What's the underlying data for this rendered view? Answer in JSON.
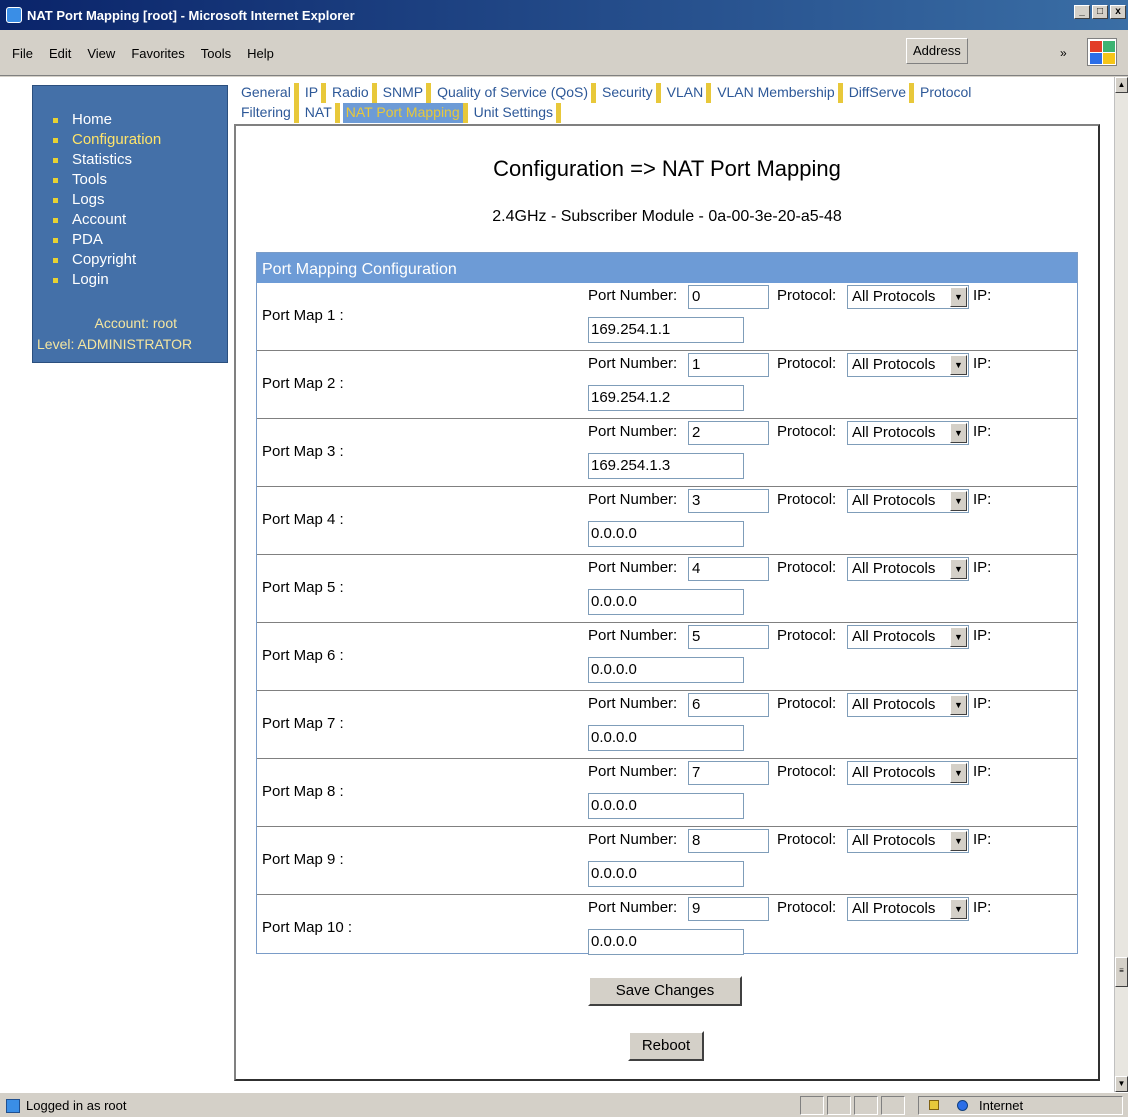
{
  "window": {
    "title": "NAT Port Mapping [root] - Microsoft Internet Explorer",
    "minimize": "_",
    "maximize": "□",
    "close": "x"
  },
  "menubar": {
    "items": [
      "File",
      "Edit",
      "View",
      "Favorites",
      "Tools",
      "Help"
    ],
    "address_label": "Address",
    "overflow": "»"
  },
  "sidebar": {
    "items": [
      {
        "label": "Home",
        "active": false
      },
      {
        "label": "Configuration",
        "active": true
      },
      {
        "label": "Statistics",
        "active": false
      },
      {
        "label": "Tools",
        "active": false
      },
      {
        "label": "Logs",
        "active": false
      },
      {
        "label": "Account",
        "active": false
      },
      {
        "label": "PDA",
        "active": false
      },
      {
        "label": "Copyright",
        "active": false
      },
      {
        "label": "Login",
        "active": false
      }
    ],
    "account": "Account: root",
    "level": "Level: ADMINISTRATOR"
  },
  "tabs": {
    "row1": [
      "General",
      "IP",
      "Radio",
      "SNMP",
      "Quality of Service (QoS)",
      "Security",
      "VLAN",
      "VLAN Membership",
      "DiffServe",
      "Protocol"
    ],
    "row2": [
      "Filtering",
      "NAT",
      "NAT Port Mapping",
      "Unit Settings"
    ],
    "active": "NAT Port Mapping"
  },
  "page": {
    "title": "Configuration => NAT Port Mapping",
    "subtitle": "2.4GHz - Subscriber Module - 0a-00-3e-20-a5-48",
    "section_header": "Port Mapping Configuration",
    "port_number_label": "Port Number:",
    "protocol_label": "Protocol:",
    "ip_label": "IP:",
    "port_maps": [
      {
        "label": "Port Map 1 :",
        "port": "0",
        "protocol": "All Protocols",
        "ip": "169.254.1.1"
      },
      {
        "label": "Port Map 2 :",
        "port": "1",
        "protocol": "All Protocols",
        "ip": "169.254.1.2"
      },
      {
        "label": "Port Map 3 :",
        "port": "2",
        "protocol": "All Protocols",
        "ip": "169.254.1.3"
      },
      {
        "label": "Port Map 4 :",
        "port": "3",
        "protocol": "All Protocols",
        "ip": "0.0.0.0"
      },
      {
        "label": "Port Map 5 :",
        "port": "4",
        "protocol": "All Protocols",
        "ip": "0.0.0.0"
      },
      {
        "label": "Port Map 6 :",
        "port": "5",
        "protocol": "All Protocols",
        "ip": "0.0.0.0"
      },
      {
        "label": "Port Map 7 :",
        "port": "6",
        "protocol": "All Protocols",
        "ip": "0.0.0.0"
      },
      {
        "label": "Port Map 8 :",
        "port": "7",
        "protocol": "All Protocols",
        "ip": "0.0.0.0"
      },
      {
        "label": "Port Map 9 :",
        "port": "8",
        "protocol": "All Protocols",
        "ip": "0.0.0.0"
      },
      {
        "label": "Port Map 10 :",
        "port": "9",
        "protocol": "All Protocols",
        "ip": "0.0.0.0"
      }
    ],
    "save_label": "Save Changes",
    "reboot_label": "Reboot"
  },
  "statusbar": {
    "text": "Logged in as root",
    "zone": "Internet"
  },
  "icons": {
    "app": "ie-icon",
    "lock": "lock-icon",
    "globe": "globe-icon",
    "dropdown": "dropdown-arrow-icon",
    "windows_logo": "windows-logo-icon"
  },
  "colors": {
    "sidebar_bg": "#4470a8",
    "tab_accent": "#e8c83a",
    "header_bg": "#6d9bd6",
    "tab_text": "#2d5898"
  }
}
